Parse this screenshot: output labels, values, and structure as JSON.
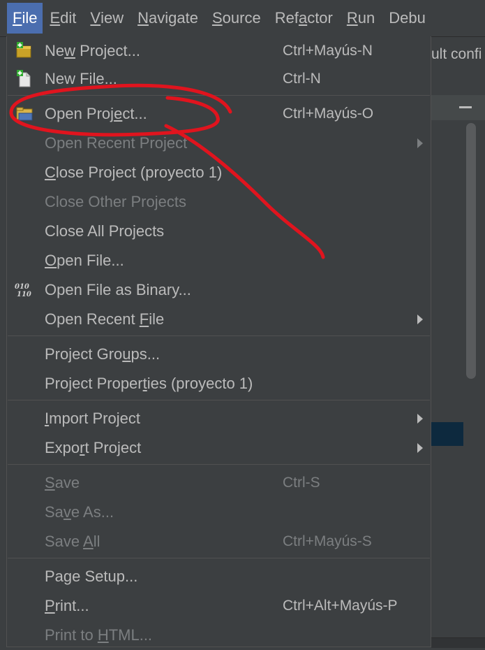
{
  "menubar": {
    "items": [
      {
        "pre": "",
        "mn": "F",
        "post": "ile"
      },
      {
        "pre": "",
        "mn": "E",
        "post": "dit"
      },
      {
        "pre": "",
        "mn": "V",
        "post": "iew"
      },
      {
        "pre": "",
        "mn": "N",
        "post": "avigate"
      },
      {
        "pre": "",
        "mn": "S",
        "post": "ource"
      },
      {
        "pre": "Ref",
        "mn": "a",
        "post": "ctor"
      },
      {
        "pre": "",
        "mn": "R",
        "post": "un"
      },
      {
        "pre": "Debu",
        "mn": "",
        "post": ""
      }
    ]
  },
  "background": {
    "toolbar_text": "ult confi"
  },
  "file_menu": {
    "items": [
      {
        "pre": "Ne",
        "mn": "w",
        "post": " Project...",
        "shortcut": "Ctrl+Mayús-N",
        "icon": "new-project-icon"
      },
      {
        "pre": "New File...",
        "mn": "",
        "post": "",
        "shortcut": "Ctrl-N",
        "icon": "new-file-icon"
      },
      {
        "pre": "Open Proj",
        "mn": "e",
        "post": "ct...",
        "shortcut": "Ctrl+Mayús-O",
        "icon": "open-project-icon"
      },
      {
        "pre": "Open Recent Project",
        "mn": "",
        "post": "",
        "shortcut": "",
        "submenu": true,
        "disabled": true
      },
      {
        "pre": "",
        "mn": "C",
        "post": "lose Project (proyecto 1)",
        "shortcut": ""
      },
      {
        "pre": "Close Other Projects",
        "mn": "",
        "post": "",
        "shortcut": "",
        "disabled": true
      },
      {
        "pre": "Close All Projects",
        "mn": "",
        "post": "",
        "shortcut": ""
      },
      {
        "pre": "",
        "mn": "O",
        "post": "pen File...",
        "shortcut": ""
      },
      {
        "pre": "Open File as Binary...",
        "mn": "",
        "post": "",
        "shortcut": "",
        "icon": "binary-file-icon",
        "icon_text": "010 110"
      },
      {
        "pre": "Open Recent ",
        "mn": "F",
        "post": "ile",
        "shortcut": "",
        "submenu": true
      },
      {
        "pre": "Project Gro",
        "mn": "u",
        "post": "ps...",
        "shortcut": ""
      },
      {
        "pre": "Project Proper",
        "mn": "t",
        "post": "ies (proyecto 1)",
        "shortcut": ""
      },
      {
        "pre": "",
        "mn": "I",
        "post": "mport Project",
        "shortcut": "",
        "submenu": true
      },
      {
        "pre": "Expo",
        "mn": "r",
        "post": "t Project",
        "shortcut": "",
        "submenu": true
      },
      {
        "pre": "",
        "mn": "S",
        "post": "ave",
        "shortcut": "Ctrl-S",
        "disabled": true
      },
      {
        "pre": "Sa",
        "mn": "v",
        "post": "e As...",
        "shortcut": "",
        "disabled": true
      },
      {
        "pre": "Save ",
        "mn": "A",
        "post": "ll",
        "shortcut": "Ctrl+Mayús-S",
        "disabled": true
      },
      {
        "pre": "Pa",
        "mn": "g",
        "post": "e Setup...",
        "shortcut": ""
      },
      {
        "pre": "",
        "mn": "P",
        "post": "rint...",
        "shortcut": "Ctrl+Alt+Mayús-P"
      },
      {
        "pre": "Print to ",
        "mn": "H",
        "post": "TML...",
        "shortcut": "",
        "disabled": true
      }
    ]
  },
  "colors": {
    "menu_bg": "#3c3f41",
    "selected_menu_bg": "#4b6eaf",
    "text": "#bbbbbb",
    "disabled_text": "#7b7e80",
    "annotation": "#e0141e"
  }
}
